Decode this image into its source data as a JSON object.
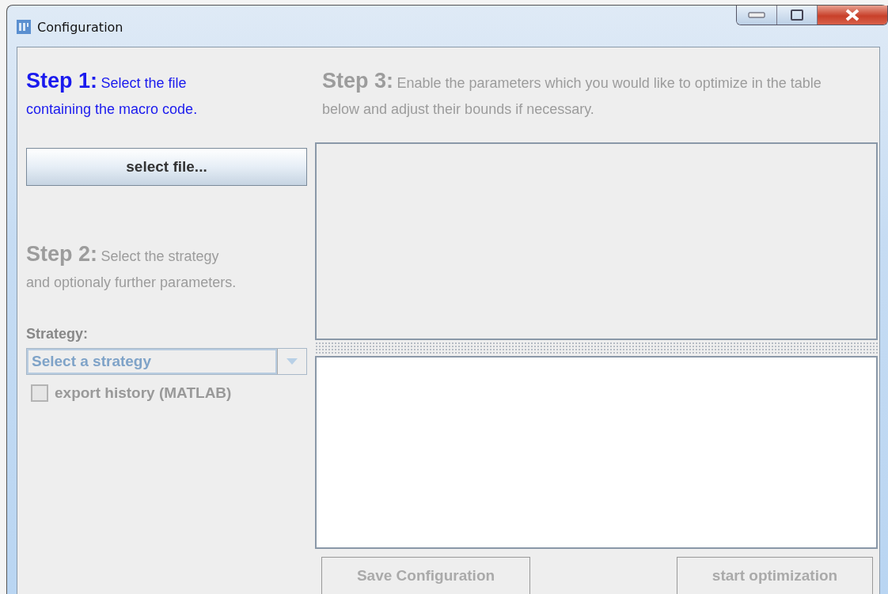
{
  "window": {
    "title": "Configuration"
  },
  "steps": [
    {
      "heading": "Step 1:",
      "text": "Select the file containing the macro code.",
      "disabled": false
    },
    {
      "heading": "Step 2:",
      "text": "Select the strategy and optionaly further parameters.",
      "disabled": true
    },
    {
      "heading": "Step 3:",
      "text": "Enable the parameters which you would like to optimize in the table below and adjust their bounds if necessary.",
      "disabled": true
    }
  ],
  "select_file_button": {
    "label": "select file...",
    "disabled": false
  },
  "strategy": {
    "label": "Strategy:",
    "placeholder": "Select a strategy",
    "disabled": true
  },
  "export_history": {
    "label": "export history (MATLAB)",
    "checked": false,
    "disabled": true
  },
  "buttons": [
    {
      "label": "Save Configuration",
      "disabled": true
    },
    {
      "label": "start optimization",
      "disabled": true
    }
  ]
}
